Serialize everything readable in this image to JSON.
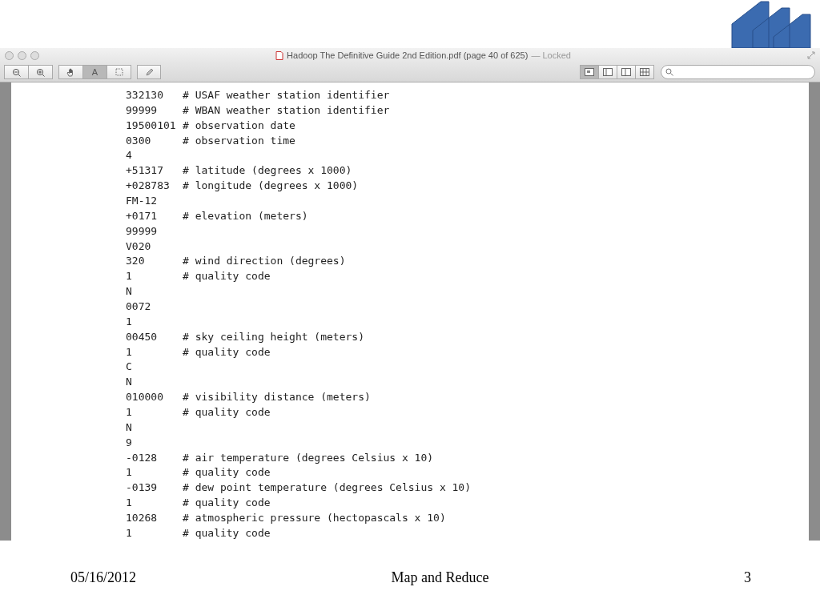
{
  "window": {
    "title": "Hadoop The Definitive Guide 2nd Edition.pdf (page 40 of 625)",
    "status": "— Locked"
  },
  "toolbar": {
    "zoom": [
      {
        "kind": "zoom-out"
      },
      {
        "kind": "zoom-in"
      }
    ],
    "tools": [
      {
        "kind": "hand",
        "selected": false
      },
      {
        "kind": "text",
        "label": "A",
        "selected": true
      },
      {
        "kind": "select",
        "selected": false
      }
    ],
    "views": [
      {
        "kind": "single",
        "selected": true
      },
      {
        "kind": "sidebar",
        "selected": false
      },
      {
        "kind": "split",
        "selected": false
      },
      {
        "kind": "grid",
        "selected": false
      }
    ]
  },
  "document": {
    "lines": [
      {
        "value": "332130",
        "comment": "# USAF weather station identifier"
      },
      {
        "value": "99999",
        "comment": "# WBAN weather station identifier"
      },
      {
        "value": "19500101",
        "comment": "# observation date"
      },
      {
        "value": "0300",
        "comment": "# observation time"
      },
      {
        "value": "4"
      },
      {
        "value": "+51317",
        "comment": "# latitude (degrees x 1000)"
      },
      {
        "value": "+028783",
        "comment": "# longitude (degrees x 1000)"
      },
      {
        "value": "FM-12"
      },
      {
        "value": "+0171",
        "comment": "# elevation (meters)"
      },
      {
        "value": "99999"
      },
      {
        "value": "V020"
      },
      {
        "value": "320",
        "comment": "# wind direction (degrees)"
      },
      {
        "value": "1",
        "comment": "# quality code"
      },
      {
        "value": "N"
      },
      {
        "value": "0072"
      },
      {
        "value": "1"
      },
      {
        "value": "00450",
        "comment": "# sky ceiling height (meters)"
      },
      {
        "value": "1",
        "comment": "# quality code"
      },
      {
        "value": "C"
      },
      {
        "value": "N"
      },
      {
        "value": "010000",
        "comment": "# visibility distance (meters)"
      },
      {
        "value": "1",
        "comment": "# quality code"
      },
      {
        "value": "N"
      },
      {
        "value": "9"
      },
      {
        "value": "-0128",
        "comment": "# air temperature (degrees Celsius x 10)"
      },
      {
        "value": "1",
        "comment": "# quality code"
      },
      {
        "value": "-0139",
        "comment": "# dew point temperature (degrees Celsius x 10)"
      },
      {
        "value": "1",
        "comment": "# quality code"
      },
      {
        "value": "10268",
        "comment": "# atmospheric pressure (hectopascals x 10)"
      },
      {
        "value": "1",
        "comment": "# quality code"
      }
    ]
  },
  "footer": {
    "date": "05/16/2012",
    "title": "Map and Reduce",
    "page": "3"
  }
}
